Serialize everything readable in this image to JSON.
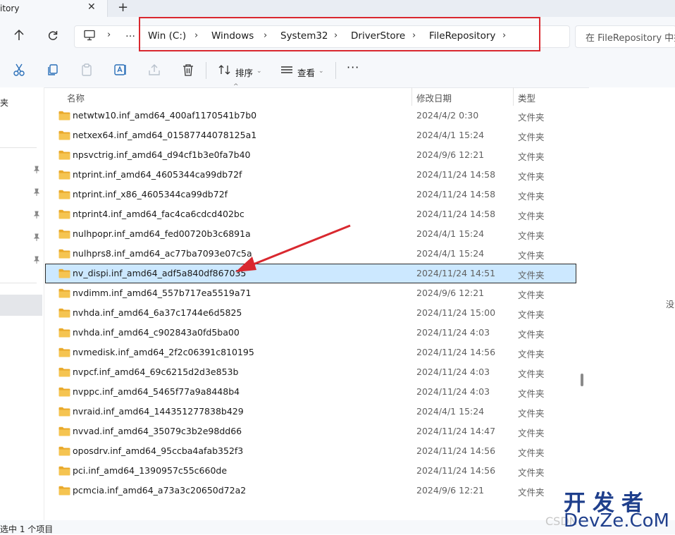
{
  "tab": {
    "title": "itory"
  },
  "address": {
    "crumbs": [
      "Win (C:)",
      "Windows",
      "System32",
      "DriverStore",
      "FileRepository"
    ],
    "search_placeholder": "在 FileRepository 中搜索"
  },
  "toolbar": {
    "sort_label": "排序",
    "view_label": "查看"
  },
  "nav": {
    "fragment_label": "夹"
  },
  "columns": {
    "name": "名称",
    "date": "修改日期",
    "type": "类型"
  },
  "rows": [
    {
      "name": "netwtw10.inf_amd64_400af1170541b7b0",
      "date": "2024/4/2 0:30",
      "type": "文件夹"
    },
    {
      "name": "netxex64.inf_amd64_01587744078125a1",
      "date": "2024/4/1 15:24",
      "type": "文件夹"
    },
    {
      "name": "npsvctrig.inf_amd64_d94cf1b3e0fa7b40",
      "date": "2024/9/6 12:21",
      "type": "文件夹"
    },
    {
      "name": "ntprint.inf_amd64_4605344ca99db72f",
      "date": "2024/11/24 14:58",
      "type": "文件夹"
    },
    {
      "name": "ntprint.inf_x86_4605344ca99db72f",
      "date": "2024/11/24 14:58",
      "type": "文件夹"
    },
    {
      "name": "ntprint4.inf_amd64_fac4ca6cdcd402bc",
      "date": "2024/11/24 14:58",
      "type": "文件夹"
    },
    {
      "name": "nulhpopr.inf_amd64_fed00720b3c6891a",
      "date": "2024/4/1 15:24",
      "type": "文件夹"
    },
    {
      "name": "nulhprs8.inf_amd64_ac77ba7093e07c5a",
      "date": "2024/4/1 15:24",
      "type": "文件夹"
    },
    {
      "name": "nv_dispi.inf_amd64_adf5a840df867035",
      "date": "2024/11/24 14:51",
      "type": "文件夹",
      "selected": true
    },
    {
      "name": "nvdimm.inf_amd64_557b717ea5519a71",
      "date": "2024/9/6 12:21",
      "type": "文件夹"
    },
    {
      "name": "nvhda.inf_amd64_6a37c1744e6d5825",
      "date": "2024/11/24 15:00",
      "type": "文件夹"
    },
    {
      "name": "nvhda.inf_amd64_c902843a0fd5ba00",
      "date": "2024/11/24 4:03",
      "type": "文件夹"
    },
    {
      "name": "nvmedisk.inf_amd64_2f2c06391c810195",
      "date": "2024/11/24 14:56",
      "type": "文件夹"
    },
    {
      "name": "nvpcf.inf_amd64_69c6215d2d3e853b",
      "date": "2024/11/24 4:03",
      "type": "文件夹"
    },
    {
      "name": "nvppc.inf_amd64_5465f77a9a8448b4",
      "date": "2024/11/24 4:03",
      "type": "文件夹"
    },
    {
      "name": "nvraid.inf_amd64_144351277838b429",
      "date": "2024/4/1 15:24",
      "type": "文件夹"
    },
    {
      "name": "nvvad.inf_amd64_35079c3b2e98dd66",
      "date": "2024/11/24 14:47",
      "type": "文件夹"
    },
    {
      "name": "oposdrv.inf_amd64_95ccba4afab352f3",
      "date": "2024/11/24 14:56",
      "type": "文件夹"
    },
    {
      "name": "pci.inf_amd64_1390957c55c660de",
      "date": "2024/11/24 14:56",
      "type": "文件夹"
    },
    {
      "name": "pcmcia.inf_amd64_a73a3c20650d72a2",
      "date": "2024/9/6 12:21",
      "type": "文件夹"
    }
  ],
  "right_pane": {
    "fragment": "没"
  },
  "status": {
    "text": "选中 1 个项目"
  },
  "watermark": {
    "top": "开发者",
    "bottom": "DevZe.CoM",
    "csdn": "CSDN"
  },
  "colors": {
    "annotation_red": "#d9282f",
    "selection": "#cce8ff",
    "folder": "#f5c451"
  }
}
